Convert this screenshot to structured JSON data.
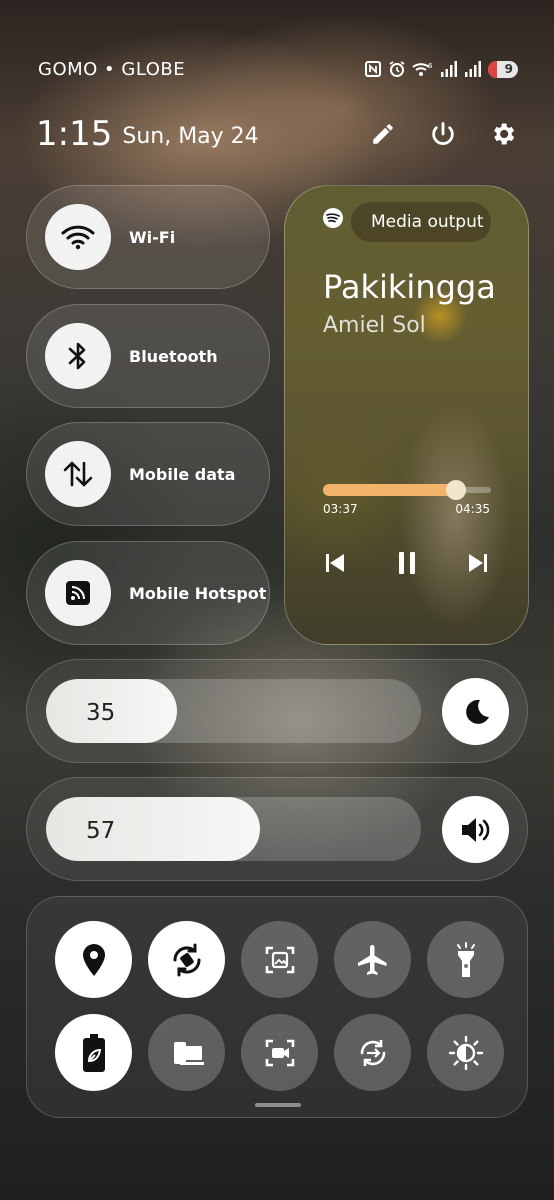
{
  "status": {
    "carrier": "GOMO • GLOBE",
    "battery": "9",
    "icons": [
      "nfc-icon",
      "alarm-icon",
      "wifi-6-icon",
      "signal-icon",
      "signal-icon",
      "battery-icon"
    ]
  },
  "header": {
    "time": "1:15",
    "date": "Sun, May 24",
    "actions": [
      "pencil-icon",
      "power-icon",
      "gear-icon"
    ]
  },
  "tiles": [
    {
      "label": "Wi-Fi",
      "icon": "wifi-icon"
    },
    {
      "label": "Bluetooth",
      "icon": "bluetooth-icon"
    },
    {
      "label": "Mobile data",
      "icon": "data-arrows-icon"
    },
    {
      "label": "Mobile Hotspot",
      "icon": "hotspot-icon"
    }
  ],
  "media": {
    "app_icon": "spotify-icon",
    "output_label": "Media output",
    "title": "Pakikinggan",
    "artist": "Amiel Sol",
    "elapsed": "03:37",
    "total": "04:35",
    "progress": 0.79
  },
  "brightness": {
    "value": "35",
    "level": 0.35,
    "icon": "moon-icon"
  },
  "volume": {
    "value": "57",
    "level": 0.57,
    "icon": "speaker-icon"
  },
  "quick_toggles": [
    {
      "name": "location-icon",
      "on": true
    },
    {
      "name": "auto-rotate-icon",
      "on": true
    },
    {
      "name": "screenshot-icon",
      "on": false
    },
    {
      "name": "airplane-icon",
      "on": false
    },
    {
      "name": "flashlight-icon",
      "on": false
    },
    {
      "name": "power-saving-icon",
      "on": true
    },
    {
      "name": "device-connect-icon",
      "on": false
    },
    {
      "name": "screen-record-icon",
      "on": false
    },
    {
      "name": "sync-icon",
      "on": false
    },
    {
      "name": "eye-comfort-icon",
      "on": false
    }
  ],
  "colors": {
    "accent": "#f2b36a",
    "tile_on": "#ffffff"
  }
}
